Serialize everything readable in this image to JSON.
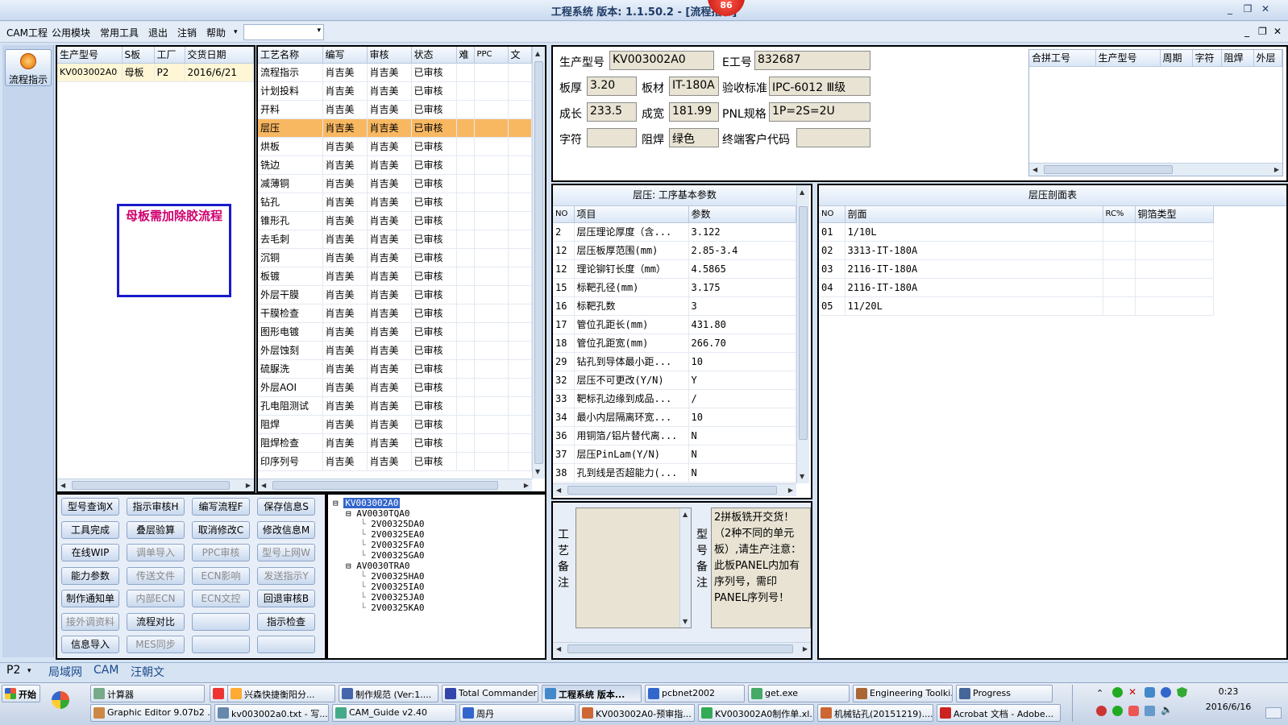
{
  "window": {
    "title": "工程系统  版本: 1.1.50.2 - [流程指示]",
    "badge": "86",
    "btn_min": "_",
    "btn_max": "❐",
    "btn_close": "✕",
    "doc_min": "_",
    "doc_max": "❐",
    "doc_close": "✕"
  },
  "menu": {
    "items": [
      "CAM工程",
      "公用模块",
      "常用工具",
      "退出",
      "注销",
      "帮助"
    ],
    "help_arrow": "▾",
    "combo_arrow": "▾"
  },
  "sidebar": {
    "flow_button": "流程指示"
  },
  "models": {
    "headers": [
      "生产型号",
      "S板",
      "工厂",
      "交货日期"
    ],
    "rows": [
      [
        "KV003002A0",
        "母板",
        "P2",
        "2016/6/21"
      ]
    ]
  },
  "note_box": {
    "text": "母板需加除胶流程"
  },
  "process": {
    "headers": [
      "工艺名称",
      "编写",
      "审核",
      "状态",
      "难",
      "PPC",
      "文"
    ],
    "rows": [
      [
        "流程指示",
        "肖吉美",
        "肖吉美",
        "已审核"
      ],
      [
        "计划投料",
        "肖吉美",
        "肖吉美",
        "已审核"
      ],
      [
        "开料",
        "肖吉美",
        "肖吉美",
        "已审核"
      ],
      [
        "层压",
        "肖吉美",
        "肖吉美",
        "已审核"
      ],
      [
        "烘板",
        "肖吉美",
        "肖吉美",
        "已审核"
      ],
      [
        "铣边",
        "肖吉美",
        "肖吉美",
        "已审核"
      ],
      [
        "减薄铜",
        "肖吉美",
        "肖吉美",
        "已审核"
      ],
      [
        "钻孔",
        "肖吉美",
        "肖吉美",
        "已审核"
      ],
      [
        "锥形孔",
        "肖吉美",
        "肖吉美",
        "已审核"
      ],
      [
        "去毛刺",
        "肖吉美",
        "肖吉美",
        "已审核"
      ],
      [
        "沉铜",
        "肖吉美",
        "肖吉美",
        "已审核"
      ],
      [
        "板镀",
        "肖吉美",
        "肖吉美",
        "已审核"
      ],
      [
        "外层干膜",
        "肖吉美",
        "肖吉美",
        "已审核"
      ],
      [
        "干膜检查",
        "肖吉美",
        "肖吉美",
        "已审核"
      ],
      [
        "图形电镀",
        "肖吉美",
        "肖吉美",
        "已审核"
      ],
      [
        "外层蚀刻",
        "肖吉美",
        "肖吉美",
        "已审核"
      ],
      [
        "硫脲洗",
        "肖吉美",
        "肖吉美",
        "已审核"
      ],
      [
        "外层AOI",
        "肖吉美",
        "肖吉美",
        "已审核"
      ],
      [
        "孔电阻测试",
        "肖吉美",
        "肖吉美",
        "已审核"
      ],
      [
        "阻焊",
        "肖吉美",
        "肖吉美",
        "已审核"
      ],
      [
        "阻焊检查",
        "肖吉美",
        "肖吉美",
        "已审核"
      ],
      [
        "印序列号",
        "肖吉美",
        "肖吉美",
        "已审核"
      ]
    ],
    "selected_index": 3
  },
  "info": {
    "l_model": "生产型号",
    "model": "KV003002A0",
    "l_eno": "E工号",
    "eno": "832687",
    "l_thick": "板厚",
    "thick": "3.20",
    "l_mat": "板材",
    "mat": "IT-180A",
    "l_std": "验收标准",
    "std": "IPC-6012 Ⅲ级",
    "l_len": "成长",
    "len": "233.5",
    "l_wid": "成宽",
    "wid": "181.99",
    "l_pnl": "PNL规格",
    "pnl": "1P=2S=2U",
    "l_char": "字符",
    "char": "",
    "l_mask": "阻焊",
    "mask": "绿色",
    "l_cust": "终端客户代码",
    "cust": ""
  },
  "combine": {
    "headers": [
      "合拼工号",
      "生产型号",
      "周期",
      "字符",
      "阻焊",
      "外层"
    ]
  },
  "params": {
    "title": "层压: 工序基本参数",
    "headers": [
      "NO",
      "项目",
      "参数"
    ],
    "rows": [
      [
        "2",
        "层压理论厚度（含...",
        "3.122"
      ],
      [
        "12",
        "层压板厚范围(mm)",
        "2.85-3.4"
      ],
      [
        "12",
        "理论铆钉长度（mm）",
        "4.5865"
      ],
      [
        "15",
        "标靶孔径(mm)",
        "3.175"
      ],
      [
        "16",
        "标靶孔数",
        "3"
      ],
      [
        "17",
        "管位孔距长(mm)",
        "431.80"
      ],
      [
        "18",
        "管位孔距宽(mm)",
        "266.70"
      ],
      [
        "29",
        "钻孔到导体最小距...",
        "10"
      ],
      [
        "32",
        "层压不可更改(Y/N)",
        "Y"
      ],
      [
        "33",
        "靶标孔边缘到成品...",
        "/"
      ],
      [
        "34",
        "最小内层隔离环宽...",
        "10"
      ],
      [
        "36",
        "用铜箔/铝片替代离...",
        "N"
      ],
      [
        "37",
        "层压PinLam(Y/N)",
        "N"
      ],
      [
        "38",
        "孔到线是否超能力(...",
        "N"
      ]
    ]
  },
  "stackup": {
    "title": "层压剖面表",
    "headers": [
      "NO",
      "剖面",
      "RC%",
      "铜箔类型"
    ],
    "rows": [
      [
        "01",
        "1/10L",
        "",
        ""
      ],
      [
        "02",
        "3313-IT-180A",
        "",
        ""
      ],
      [
        "03",
        "2116-IT-180A",
        "",
        ""
      ],
      [
        "04",
        "2116-IT-180A",
        "",
        ""
      ],
      [
        "05",
        "11/20L",
        "",
        ""
      ]
    ]
  },
  "buttons": [
    {
      "label": "型号查询X",
      "disabled": false
    },
    {
      "label": "指示审核H",
      "disabled": false
    },
    {
      "label": "编写流程F",
      "disabled": false
    },
    {
      "label": "保存信息S",
      "disabled": false
    },
    {
      "label": "工具完成",
      "disabled": false
    },
    {
      "label": "叠层验算",
      "disabled": false
    },
    {
      "label": "取消修改C",
      "disabled": false
    },
    {
      "label": "修改信息M",
      "disabled": false
    },
    {
      "label": "在线WIP",
      "disabled": false
    },
    {
      "label": "调单导入",
      "disabled": true
    },
    {
      "label": "PPC审核",
      "disabled": true
    },
    {
      "label": "型号上网W",
      "disabled": true
    },
    {
      "label": "能力参数",
      "disabled": false
    },
    {
      "label": "传送文件",
      "disabled": true
    },
    {
      "label": "ECN影响",
      "disabled": true
    },
    {
      "label": "发送指示Y",
      "disabled": true
    },
    {
      "label": "制作通知单",
      "disabled": false
    },
    {
      "label": "内部ECN",
      "disabled": true
    },
    {
      "label": "ECN文控",
      "disabled": true
    },
    {
      "label": "回退审核B",
      "disabled": false
    },
    {
      "label": "接外调资料",
      "disabled": true
    },
    {
      "label": "流程对比",
      "disabled": false
    },
    {
      "label": "",
      "disabled": false
    },
    {
      "label": "指示检查",
      "disabled": false
    },
    {
      "label": "信息导入",
      "disabled": false
    },
    {
      "label": "MES同步",
      "disabled": true
    },
    {
      "label": "",
      "disabled": false
    },
    {
      "label": "",
      "disabled": false
    }
  ],
  "tree": {
    "root": "KV003002A0",
    "groups": [
      {
        "name": "AV0030TQA0",
        "children": [
          "2V00325DA0",
          "2V00325EA0",
          "2V00325FA0",
          "2V00325GA0"
        ]
      },
      {
        "name": "AV0030TRA0",
        "children": [
          "2V00325HA0",
          "2V00325IA0",
          "2V00325JA0",
          "2V00325KA0"
        ]
      }
    ]
  },
  "remarks": {
    "process_label": "工艺备注",
    "model_label": "型号备注",
    "model_note": "2拼板铣开交货！（2种不同的单元板）,请生产注意：此板PANEL内加有序列号，需印PANEL序列号！"
  },
  "status": {
    "combo": "P2",
    "items": [
      "局域网",
      "CAM",
      "汪朝文"
    ]
  },
  "taskbar": {
    "start": "开始",
    "row1": [
      "计算器",
      "",
      "兴森快捷衡阳分...",
      "制作规范 (Ver:1....",
      "Total Commander ...",
      "工程系统  版本...",
      "pcbnet2002",
      "get.exe",
      "Engineering Toolki...",
      "Progress"
    ],
    "row2": [
      "Graphic Editor 9.07b2 ...",
      "kv003002a0.txt - 写...",
      "CAM_Guide v2.40",
      "周丹",
      "KV003002A0-预审指...",
      "KV003002A0制作单.xl...",
      "机械钻孔(20151219)....",
      "Acrobat 文档 - Adobe..."
    ],
    "time": "0:23",
    "date": "2016/6/16"
  },
  "colors": {
    "selected_row": "#f8b862",
    "note_border": "#1a1acc",
    "note_text": "#d0006f"
  }
}
